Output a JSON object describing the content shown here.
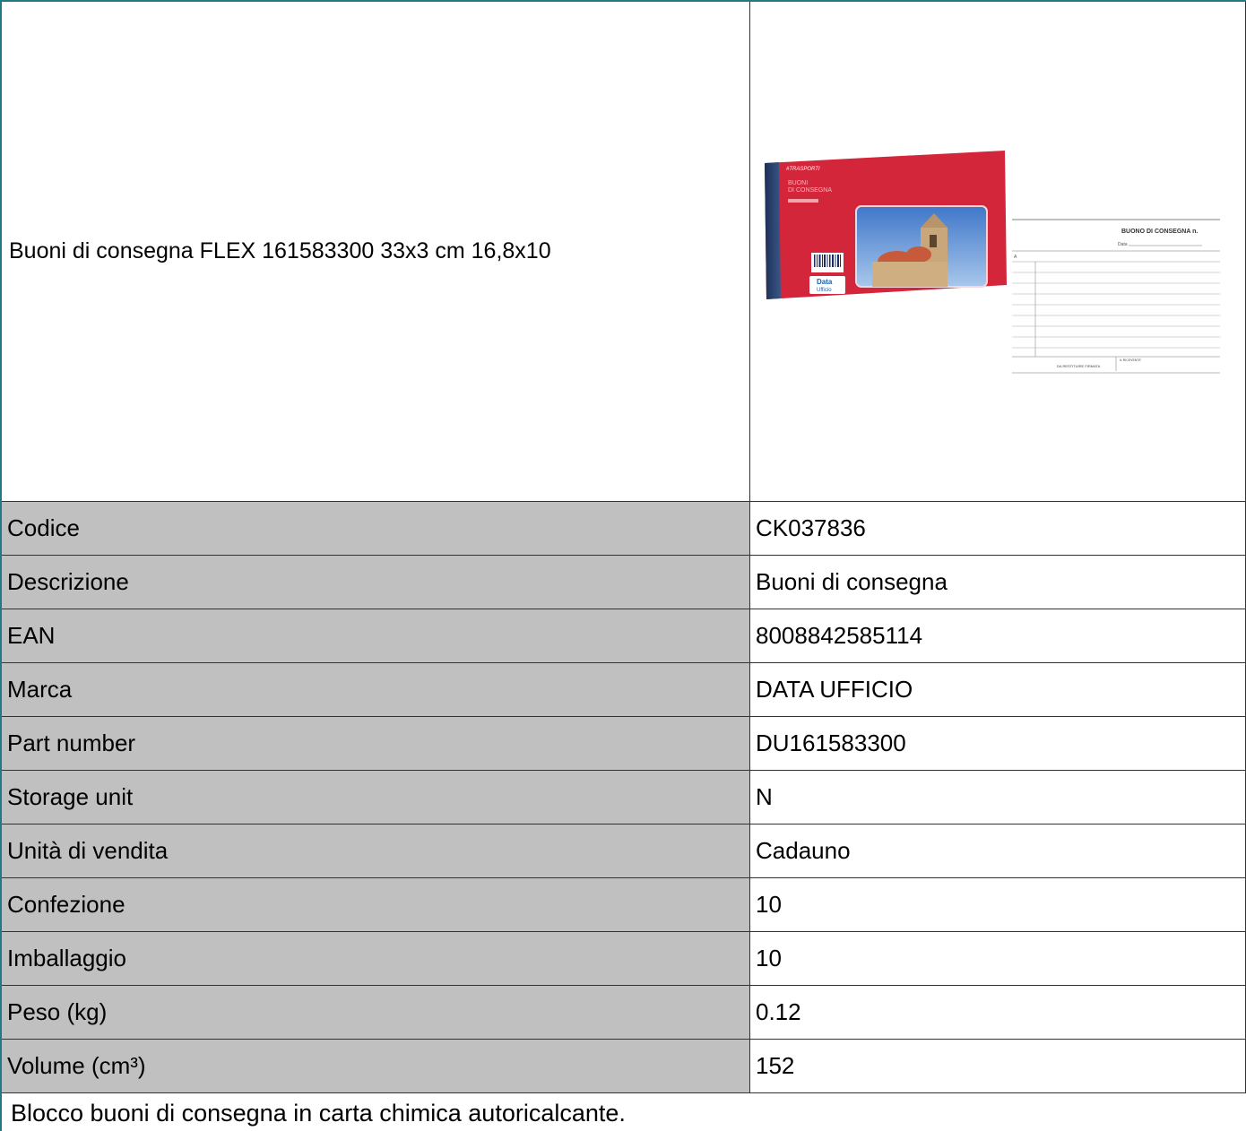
{
  "product": {
    "title": "Buoni di consegna FLEX 161583300 33x3 cm 16,8x10"
  },
  "photo": {
    "cover_series": "#TRASPORTI",
    "cover_title_line1": "BUONI",
    "cover_title_line2": "DI CONSEGNA",
    "brand_logo_top": "Data",
    "brand_logo_bottom": "Ufficio",
    "form_title": "BUONO DI CONSEGNA n.",
    "form_date_label": "Data",
    "form_a_label": "A",
    "form_footer_label": "DA RESTITUIRE FIRMATA",
    "form_received_label": "IL RICEVENTE"
  },
  "specs": [
    {
      "label": "Codice",
      "value": "CK037836"
    },
    {
      "label": "Descrizione",
      "value": "Buoni di consegna"
    },
    {
      "label": "EAN",
      "value": "8008842585114"
    },
    {
      "label": "Marca",
      "value": "DATA UFFICIO"
    },
    {
      "label": "Part number",
      "value": "DU161583300"
    },
    {
      "label": "Storage unit",
      "value": "N"
    },
    {
      "label": "Unità di vendita",
      "value": "Cadauno"
    },
    {
      "label": "Confezione",
      "value": "10"
    },
    {
      "label": "Imballaggio",
      "value": "10"
    },
    {
      "label": "Peso (kg)",
      "value": "0.12"
    },
    {
      "label": "Volume (cm³)",
      "value": "152"
    }
  ],
  "description": "Blocco buoni di consegna in carta chimica autoricalcante.",
  "colors": {
    "frame": "#1f7a86",
    "label_bg": "#c0c0c0",
    "cover_red": "#d3263a"
  }
}
